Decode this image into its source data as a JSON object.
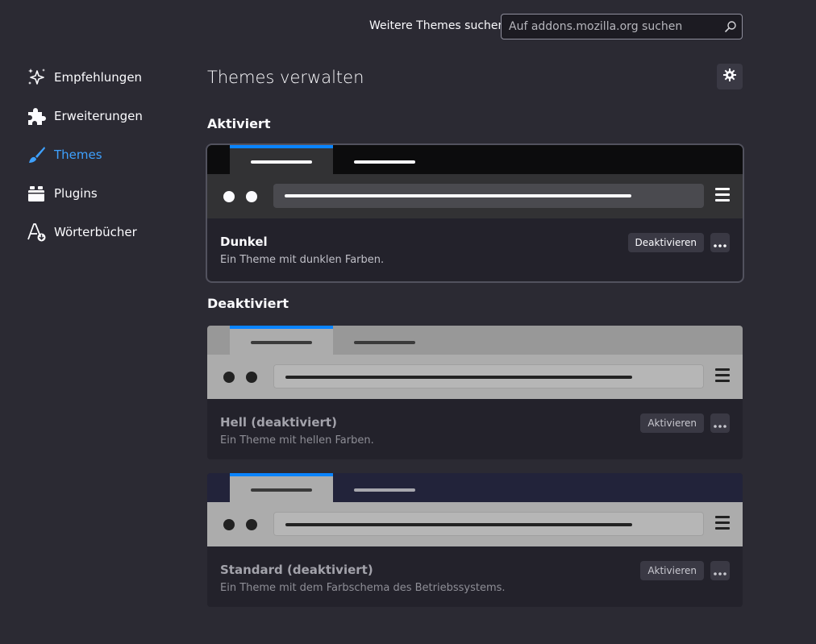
{
  "search": {
    "label": "Weitere Themes suchen",
    "placeholder": "Auf addons.mozilla.org suchen",
    "value": ""
  },
  "sidebar": {
    "items": [
      {
        "label": "Empfehlungen",
        "icon": "sparkle-icon",
        "active": false
      },
      {
        "label": "Erweiterungen",
        "icon": "puzzle-icon",
        "active": false
      },
      {
        "label": "Themes",
        "icon": "brush-icon",
        "active": true
      },
      {
        "label": "Plugins",
        "icon": "plugin-icon",
        "active": false
      },
      {
        "label": "Wörterbücher",
        "icon": "dictionary-icon",
        "active": false
      }
    ]
  },
  "main": {
    "title": "Themes verwalten",
    "sections": {
      "enabled_title": "Aktiviert",
      "disabled_title": "Deaktiviert"
    },
    "themes": [
      {
        "name": "Dunkel",
        "description": "Ein Theme mit dunklen Farben.",
        "action_label": "Deaktivieren",
        "enabled": true
      },
      {
        "name": "Hell (deaktiviert)",
        "description": "Ein Theme mit hellen Farben.",
        "action_label": "Aktivieren",
        "enabled": false
      },
      {
        "name": "Standard (deaktiviert)",
        "description": "Ein Theme mit dem Farbschema des Betriebssystems.",
        "action_label": "Aktivieren",
        "enabled": false
      }
    ]
  },
  "colors": {
    "background": "#2b2a33",
    "accent": "#0a84ff",
    "active_nav": "#3ea1ff"
  }
}
